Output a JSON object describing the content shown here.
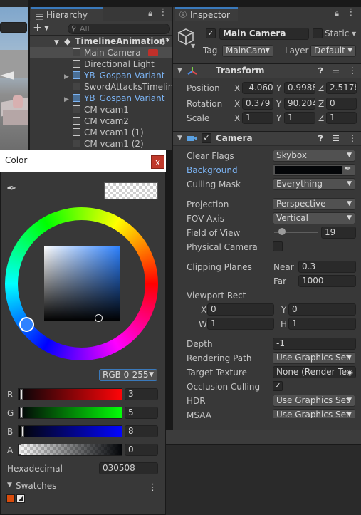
{
  "hierarchy": {
    "tab_label": "Hierarchy",
    "search_placeholder": "All",
    "add_label": "+",
    "rows": [
      {
        "label": "TimelineAnimation*"
      },
      {
        "label": "Main Camera"
      },
      {
        "label": "Directional Light"
      },
      {
        "label": "YB_Gospan Variant"
      },
      {
        "label": "SwordAttacksTimeline"
      },
      {
        "label": "YB_Gospan Variant"
      },
      {
        "label": "CM vcam1"
      },
      {
        "label": "CM vcam2"
      },
      {
        "label": "CM vcam1 (1)"
      },
      {
        "label": "CM vcam1 (2)"
      }
    ]
  },
  "inspector": {
    "tab_label": "Inspector",
    "object_name": "Main Camera",
    "static_label": "Static",
    "tag_label": "Tag",
    "tag_value": "MainCam",
    "layer_label": "Layer",
    "layer_value": "Default",
    "transform": {
      "title": "Transform",
      "position_label": "Position",
      "rotation_label": "Rotation",
      "scale_label": "Scale",
      "position": {
        "x": "-4.060",
        "y": "0.9988",
        "z": "2.5178"
      },
      "rotation": {
        "x": "0.379",
        "y": "90.204",
        "z": "0"
      },
      "scale": {
        "x": "1",
        "y": "1",
        "z": "1"
      }
    },
    "camera": {
      "title": "Camera",
      "clear_flags_label": "Clear Flags",
      "clear_flags_value": "Skybox",
      "background_label": "Background",
      "culling_mask_label": "Culling Mask",
      "culling_mask_value": "Everything",
      "projection_label": "Projection",
      "projection_value": "Perspective",
      "fov_axis_label": "FOV Axis",
      "fov_axis_value": "Vertical",
      "fov_label": "Field of View",
      "fov_value": "19",
      "fov_slider_fraction": 0.1,
      "physical_camera_label": "Physical Camera",
      "clipping_label": "Clipping Planes",
      "near_label": "Near",
      "near_value": "0.3",
      "far_label": "Far",
      "far_value": "1000",
      "viewport_label": "Viewport Rect",
      "vp_x_label": "X",
      "vp_x": "0",
      "vp_y_label": "Y",
      "vp_y": "0",
      "vp_w_label": "W",
      "vp_w": "1",
      "vp_h_label": "H",
      "vp_h": "1",
      "depth_label": "Depth",
      "depth_value": "-1",
      "rendering_path_label": "Rendering Path",
      "rendering_path_value": "Use Graphics Set",
      "target_texture_label": "Target Texture",
      "target_texture_value": "None (Render Te",
      "occlusion_label": "Occlusion Culling",
      "hdr_label": "HDR",
      "hdr_value": "Use Graphics Set",
      "msaa_label": "MSAA",
      "msaa_value": "Use Graphics Set"
    },
    "labels": {
      "x": "X",
      "y": "Y",
      "z": "Z"
    }
  },
  "color_window": {
    "title": "Color",
    "close_label": "x",
    "mode_value": "RGB 0-255",
    "r_label": "R",
    "r_value": "3",
    "g_label": "G",
    "g_value": "5",
    "b_label": "B",
    "b_value": "8",
    "a_label": "A",
    "a_value": "0",
    "hex_label": "Hexadecimal",
    "hex_value": "030508",
    "swatches_label": "Swatches",
    "swatch_color": "#d94c0c"
  },
  "colors": {
    "accent": "#3a79bb",
    "selected_color": "#030508",
    "blue_text": "#7cb4f4"
  }
}
